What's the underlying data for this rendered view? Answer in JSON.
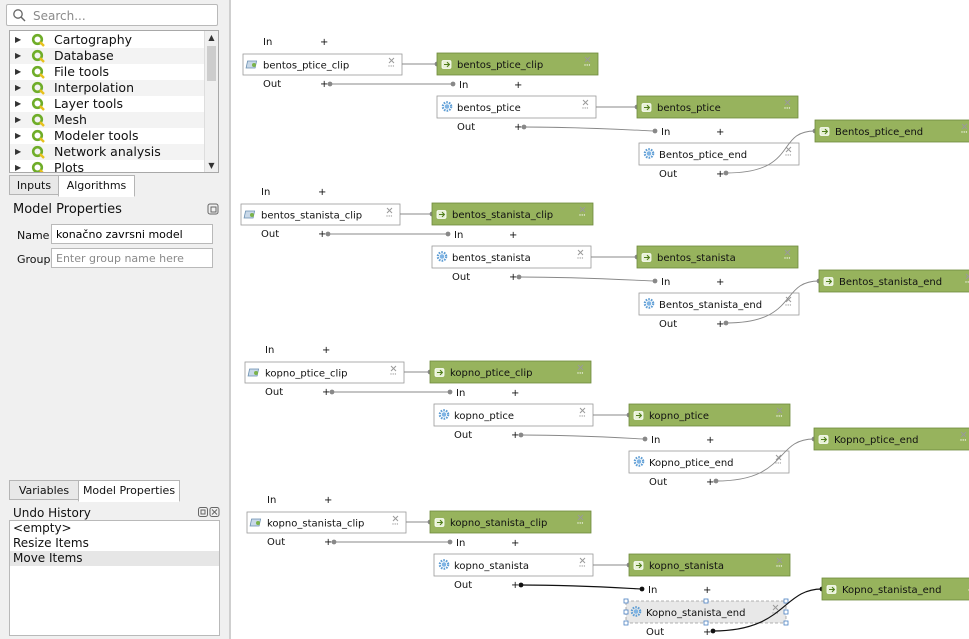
{
  "search": {
    "placeholder": "Search..."
  },
  "tree": {
    "items": [
      {
        "label": "Cartography"
      },
      {
        "label": "Database"
      },
      {
        "label": "File tools"
      },
      {
        "label": "Interpolation"
      },
      {
        "label": "Layer tools"
      },
      {
        "label": "Mesh"
      },
      {
        "label": "Modeler tools"
      },
      {
        "label": "Network analysis"
      },
      {
        "label": "Plots"
      }
    ]
  },
  "tabs_top": {
    "inputs": "Inputs",
    "algorithms": "Algorithms"
  },
  "model_properties": {
    "title": "Model Properties",
    "name_label": "Name",
    "name_value": "konačno zavrsni model",
    "group_label": "Group",
    "group_placeholder": "Enter group name here"
  },
  "tabs_bottom": {
    "variables": "Variables",
    "model_properties": "Model Properties"
  },
  "undo": {
    "title": "Undo History",
    "items": [
      "<empty>",
      "Resize Items",
      "Move Items"
    ]
  },
  "graph": {
    "in_label": "In",
    "out_label": "Out",
    "plus": "+",
    "groups": [
      {
        "clip_input": "bentos_ptice_clip",
        "clip_output": "bentos_ptice_clip",
        "layer_input": "bentos_ptice",
        "layer_output": "bentos_ptice",
        "end_alg": "Bentos_ptice_end",
        "end_output": "Bentos_ptice_end"
      },
      {
        "clip_input": "bentos_stanista_clip",
        "clip_output": "bentos_stanista_clip",
        "layer_input": "bentos_stanista",
        "layer_output": "bentos_stanista",
        "end_alg": "Bentos_stanista_end",
        "end_output": "Bentos_stanista_end"
      },
      {
        "clip_input": "kopno_ptice_clip",
        "clip_output": "kopno_ptice_clip",
        "layer_input": "kopno_ptice",
        "layer_output": "kopno_ptice",
        "end_alg": "Kopno_ptice_end",
        "end_output": "Kopno_ptice_end"
      },
      {
        "clip_input": "kopno_stanista_clip",
        "clip_output": "kopno_stanista_clip",
        "layer_input": "kopno_stanista",
        "layer_output": "kopno_stanista",
        "end_alg": "Kopno_stanista_end",
        "end_output": "Kopno_stanista_end"
      }
    ]
  },
  "colors": {
    "output_fill": "#97b35d",
    "output_border": "#6f8a3c",
    "algorithm_fill": "#ffffff",
    "node_border": "#9a9a9a",
    "selected_fill": "#e8e8e8",
    "connector": "#888888"
  },
  "icons": {
    "search": "search-icon",
    "tree_expand": "chevron-right-icon",
    "processing": "qgis-processing-icon",
    "input_layer": "vector-layer-icon",
    "algorithm": "gear-icon",
    "output": "output-arrow-icon",
    "node_close": "close-icon",
    "node_more": "more-icon"
  }
}
